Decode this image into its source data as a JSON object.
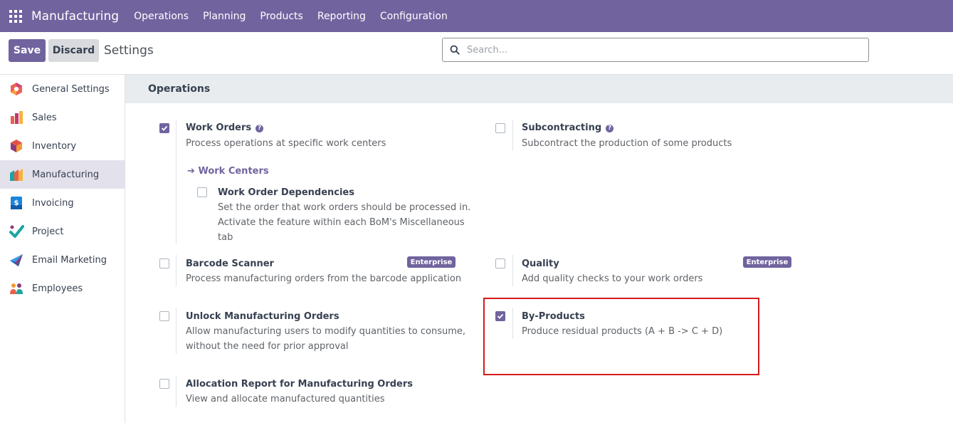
{
  "navbar": {
    "brand": "Manufacturing",
    "menu": [
      "Operations",
      "Planning",
      "Products",
      "Reporting",
      "Configuration"
    ]
  },
  "control": {
    "save_label": "Save",
    "discard_label": "Discard",
    "title": "Settings",
    "search_placeholder": "Search..."
  },
  "sidebar": {
    "items": [
      {
        "label": "General Settings",
        "icon": "general-settings-icon"
      },
      {
        "label": "Sales",
        "icon": "sales-icon"
      },
      {
        "label": "Inventory",
        "icon": "inventory-icon"
      },
      {
        "label": "Manufacturing",
        "icon": "manufacturing-icon",
        "active": true
      },
      {
        "label": "Invoicing",
        "icon": "invoicing-icon"
      },
      {
        "label": "Project",
        "icon": "project-icon"
      },
      {
        "label": "Email Marketing",
        "icon": "email-marketing-icon"
      },
      {
        "label": "Employees",
        "icon": "employees-icon"
      }
    ]
  },
  "section": {
    "title": "Operations",
    "work_orders": {
      "title": "Work Orders",
      "desc": "Process operations at specific work centers",
      "checked": true
    },
    "work_centers_link": "Work Centers",
    "work_order_dependencies": {
      "title": "Work Order Dependencies",
      "desc": "Set the order that work orders should be processed in. Activate the feature within each BoM's Miscellaneous tab",
      "checked": false
    },
    "subcontracting": {
      "title": "Subcontracting",
      "desc": "Subcontract the production of some products",
      "checked": false
    },
    "barcode_scanner": {
      "title": "Barcode Scanner",
      "desc": "Process manufacturing orders from the barcode application",
      "badge": "Enterprise",
      "checked": false
    },
    "quality": {
      "title": "Quality",
      "desc": "Add quality checks to your work orders",
      "badge": "Enterprise",
      "checked": false
    },
    "unlock_mo": {
      "title": "Unlock Manufacturing Orders",
      "desc": "Allow manufacturing users to modify quantities to consume, without the need for prior approval",
      "checked": false
    },
    "by_products": {
      "title": "By-Products",
      "desc": "Produce residual products (A + B -> C + D)",
      "checked": true
    },
    "allocation_report": {
      "title": "Allocation Report for Manufacturing Orders",
      "desc": "View and allocate manufactured quantities",
      "checked": false
    }
  },
  "colors": {
    "brand": "#71639e",
    "highlight": "#d61a1a"
  }
}
